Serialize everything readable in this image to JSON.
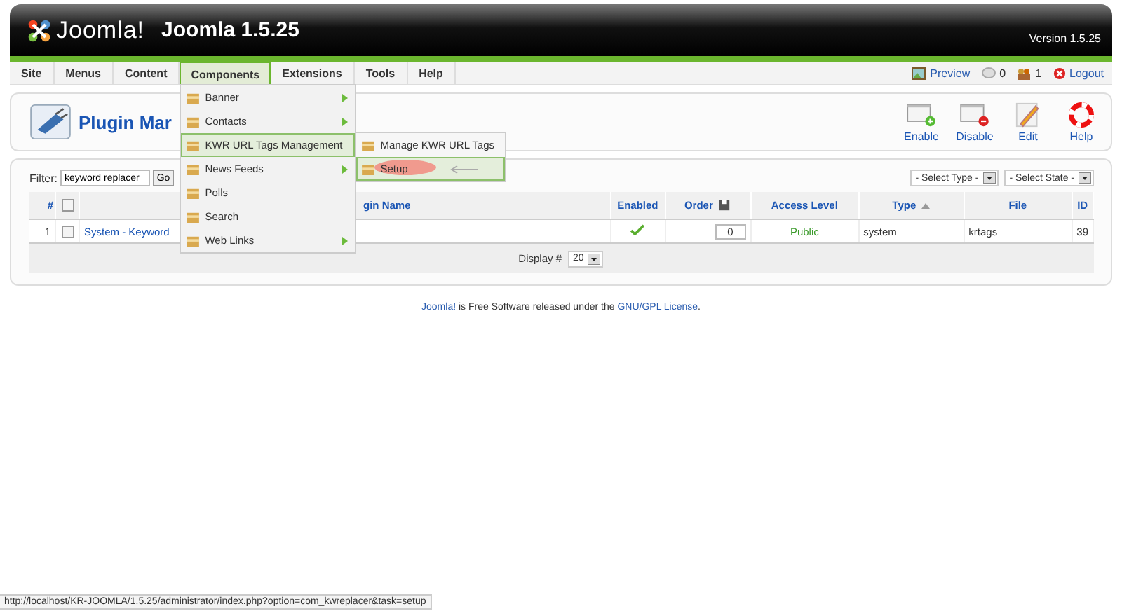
{
  "header": {
    "logo": "Joomla!",
    "title": "Joomla 1.5.25",
    "version": "Version 1.5.25"
  },
  "menubar": {
    "items": [
      {
        "label": "Site",
        "selected": false
      },
      {
        "label": "Menus",
        "selected": false
      },
      {
        "label": "Content",
        "selected": false
      },
      {
        "label": "Components",
        "selected": true
      },
      {
        "label": "Extensions",
        "selected": false
      },
      {
        "label": "Tools",
        "selected": false
      },
      {
        "label": "Help",
        "selected": false
      }
    ],
    "status": [
      {
        "kind": "preview",
        "label": "Preview"
      },
      {
        "kind": "messages",
        "label": "0"
      },
      {
        "kind": "users",
        "label": "1"
      },
      {
        "kind": "logout",
        "label": "Logout"
      }
    ]
  },
  "dropdown": [
    {
      "label": "Banner",
      "submenu": true,
      "selected": false
    },
    {
      "label": "Contacts",
      "submenu": true,
      "selected": false
    },
    {
      "label": "KWR URL Tags Management",
      "submenu": false,
      "selected": true
    },
    {
      "label": "News Feeds",
      "submenu": true,
      "selected": false
    },
    {
      "label": "Polls",
      "submenu": false,
      "selected": false
    },
    {
      "label": "Search",
      "submenu": false,
      "selected": false
    },
    {
      "label": "Web Links",
      "submenu": true,
      "selected": false
    }
  ],
  "submenu": [
    {
      "label": "Manage KWR URL Tags",
      "selected": false
    },
    {
      "label": "Setup",
      "selected": true
    }
  ],
  "page_title": "Plugin Mar",
  "toolbar": [
    {
      "kind": "enable",
      "label": "Enable"
    },
    {
      "kind": "disable",
      "label": "Disable"
    },
    {
      "kind": "edit",
      "label": "Edit"
    },
    {
      "kind": "help",
      "label": "Help"
    }
  ],
  "filter": {
    "label": "Filter:",
    "value": "keyword replacer",
    "button": "Go"
  },
  "selects": [
    "- Select Type -",
    "- Select State -"
  ],
  "table": {
    "columns": [
      {
        "kind": "text",
        "label": "#"
      },
      {
        "kind": "checkbox",
        "checked": false
      },
      {
        "kind": "name",
        "label": "gin Name"
      },
      {
        "kind": "text",
        "label": "Enabled"
      },
      {
        "kind": "save",
        "label": "Order"
      },
      {
        "kind": "text",
        "label": "Access Level"
      },
      {
        "kind": "sorted",
        "label": "Type"
      },
      {
        "kind": "text",
        "label": "File"
      },
      {
        "kind": "text",
        "label": "ID"
      }
    ],
    "rows": [
      {
        "num": "1",
        "checked": false,
        "name": "System - Keyword",
        "enabled": true,
        "order": "0",
        "access": "Public",
        "type": "system",
        "file": "krtags",
        "id": "39"
      }
    ]
  },
  "display": {
    "label": "Display #",
    "value": "20"
  },
  "footer": {
    "link1": "Joomla!",
    "text": " is Free Software released under the ",
    "link2": "GNU/GPL License",
    "end": "."
  },
  "status_bar": "http://localhost/KR-JOOMLA/1.5.25/administrator/index.php?option=com_kwreplacer&task=setup"
}
